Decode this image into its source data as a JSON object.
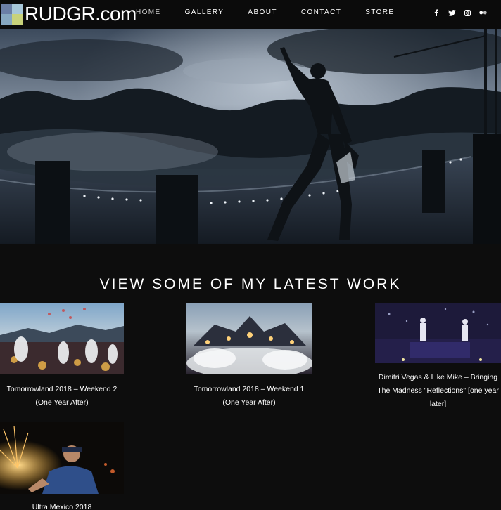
{
  "site": {
    "logo_text": "RUDGR.com",
    "logo_colors": [
      "#6b7fa6",
      "#a7c7d9",
      "#86a7c0",
      "#c8d27a"
    ]
  },
  "nav": {
    "items": [
      {
        "label": "HOME"
      },
      {
        "label": "GALLERY"
      },
      {
        "label": "ABOUT"
      },
      {
        "label": "CONTACT"
      },
      {
        "label": "STORE"
      }
    ],
    "socials": [
      "facebook-icon",
      "twitter-icon",
      "instagram-icon",
      "flickr-icon"
    ]
  },
  "section": {
    "title": "VIEW SOME OF MY LATEST WORK"
  },
  "posts": [
    {
      "title": "Tomorrowland 2018 – Weekend 2 (One Year After)"
    },
    {
      "title": "Tomorrowland 2018 – Weekend 1 (One Year After)"
    },
    {
      "title": "Dimitri Vegas & Like Mike – Bringing The Madness \"Reflections\" [one year later]"
    },
    {
      "title": "Ultra Mexico 2018"
    }
  ],
  "colors": {
    "background": "#0d0d0d",
    "nav_background": "#0b0b0b",
    "text": "#ffffff"
  }
}
